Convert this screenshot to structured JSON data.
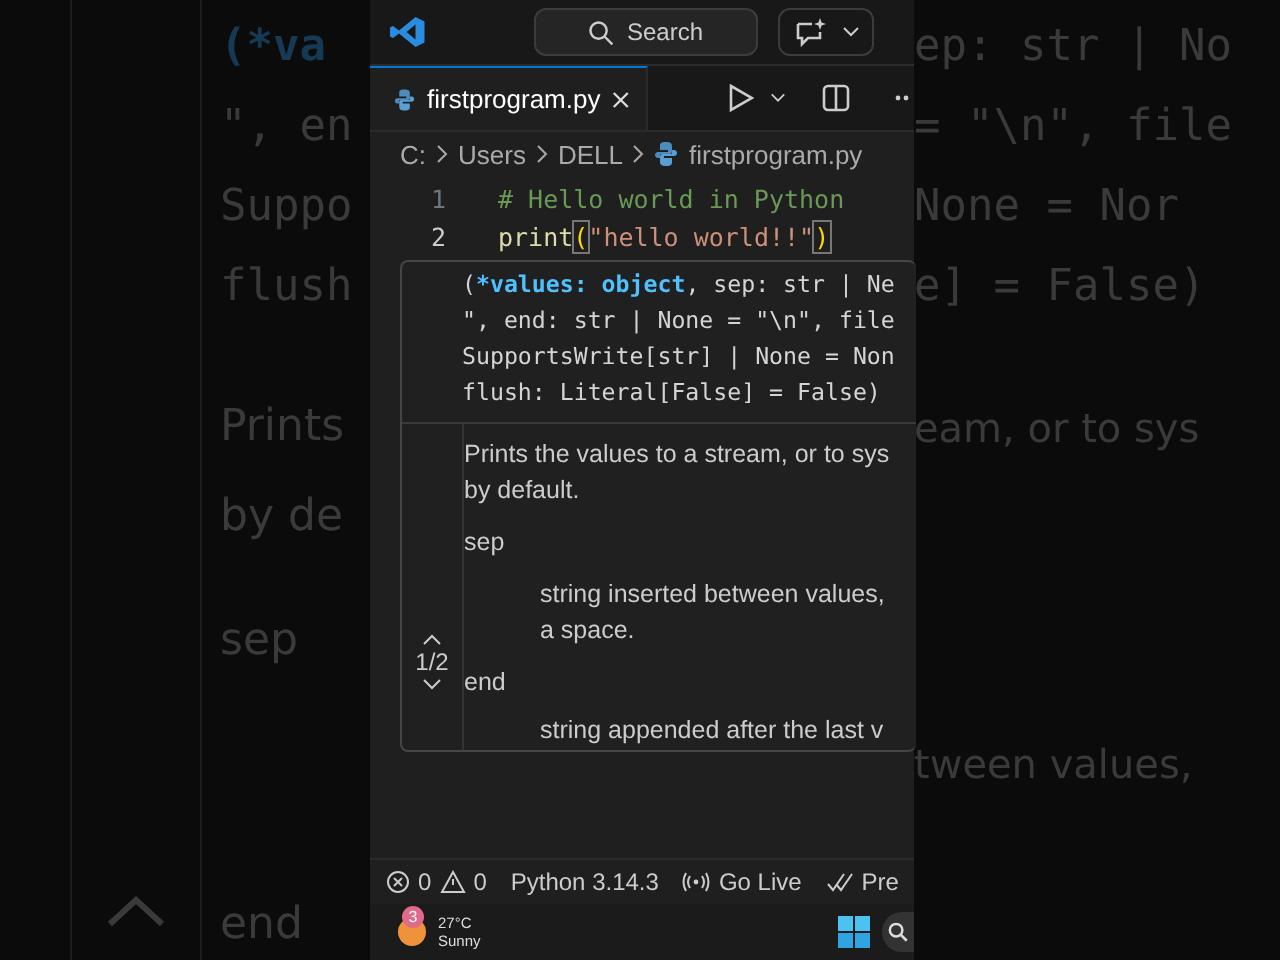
{
  "backdrop": {
    "left_lines": [
      "(*va",
      "\", en",
      "Suppo",
      "flush",
      "Prints",
      "by de",
      "sep",
      "end"
    ],
    "right_lines": [
      "ep: str | No",
      "= \"\\n\", file",
      "None = Nor",
      "e] = False)",
      "eam, or to sys",
      "tween values,"
    ]
  },
  "title_bar": {
    "search": "Search"
  },
  "tab": {
    "label": "firstprogram.py",
    "selected": true
  },
  "breadcrumb": [
    "C:",
    "Users",
    "DELL",
    "firstprogram.py"
  ],
  "code": [
    {
      "number": "1",
      "kind": "comment",
      "text": "# Hello world in Python"
    },
    {
      "number": "2",
      "kind": "call",
      "func": "print",
      "open": "(",
      "string": "\"hello world!!\"",
      "close": ")"
    }
  ],
  "hover": {
    "signature": [
      {
        "kind": "active",
        "before": "(",
        "param": "*values: object",
        "after": ", sep: str | Ne"
      },
      {
        "kind": "plain",
        "text": "\", end: str | None = \"\\n\", file"
      },
      {
        "kind": "plain",
        "text": "SupportsWrite[str] | None = Non"
      },
      {
        "kind": "plain",
        "text": "flush: Literal[False] = False)"
      }
    ],
    "description": [
      "Prints the values to a stream, or to sys",
      "by default."
    ],
    "params": [
      {
        "name": "sep",
        "lines": [
          "string inserted between values,",
          "a space."
        ]
      },
      {
        "name": "end",
        "lines": [
          "string appended after the last v"
        ]
      }
    ],
    "pager": "1/2"
  },
  "status_bar": {
    "errors": "0",
    "warnings": "0",
    "python": "Python 3.14.3",
    "live": "Go Live",
    "prettier": "Pre"
  },
  "taskbar": {
    "badge": "3",
    "temperature": "27°C",
    "weather": "Sunny"
  }
}
